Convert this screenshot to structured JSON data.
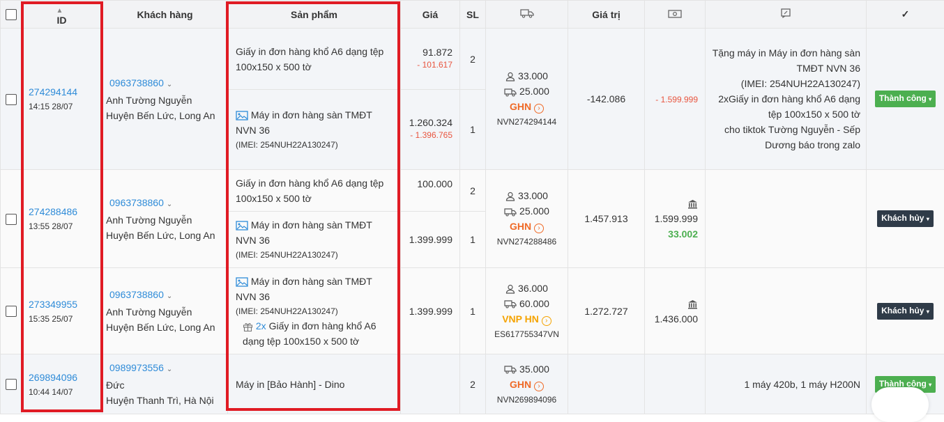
{
  "header": {
    "id": "ID",
    "customer": "Khách hàng",
    "product": "Sản phẩm",
    "price": "Giá",
    "qty": "SL",
    "shipping_icon": "truck-icon",
    "value": "Giá trị",
    "payment_icon": "money-icon",
    "note_icon": "note-icon",
    "status": "✓"
  },
  "orders": [
    {
      "id": "274294144",
      "time": "14:15 28/07",
      "phone": "0963738860",
      "name": "Anh Tường Nguyễn",
      "address": "Huyện Bến Lức, Long An",
      "p1": {
        "name": "Giấy in đơn hàng khổ A6 dạng tệp 100x150 x 500 tờ",
        "price": "91.872",
        "disc": "- 101.617",
        "qty": "2"
      },
      "p2": {
        "name": "Máy in đơn hàng sàn TMĐT NVN 36",
        "imei": "(IMEI: 254NUH22A130247)",
        "price": "1.260.324",
        "disc": "- 1.396.765",
        "qty": "1"
      },
      "ship_fee": "33.000",
      "ship_cost": "25.000",
      "carrier": "GHN",
      "tracking": "NVN274294144",
      "value": "-142.086",
      "payment": "- 1.599.999",
      "note": [
        "Tặng máy in Máy in đơn hàng sàn",
        "TMĐT NVN 36",
        "(IMEI: 254NUH22A130247)",
        "2xGiấy in đơn hàng khổ A6 dạng",
        "tệp 100x150 x 500 tờ",
        "cho tiktok Tường Nguyễn - Sếp",
        "Dương báo trong zalo"
      ],
      "status": "Thành công"
    },
    {
      "id": "274288486",
      "time": "13:55 28/07",
      "phone": "0963738860",
      "name": "Anh Tường Nguyễn",
      "address": "Huyện Bến Lức, Long An",
      "p1": {
        "name": "Giấy in đơn hàng khổ A6 dạng tệp 100x150 x 500 tờ",
        "price": "100.000",
        "qty": "2"
      },
      "p2": {
        "name": "Máy in đơn hàng sàn TMĐT NVN 36",
        "imei": "(IMEI: 254NUH22A130247)",
        "price": "1.399.999",
        "qty": "1"
      },
      "ship_fee": "33.000",
      "ship_cost": "25.000",
      "carrier": "GHN",
      "tracking": "NVN274288486",
      "value": "1.457.913",
      "payment": "1.599.999",
      "payment_extra": "33.002",
      "status": "Khách hủy"
    },
    {
      "id": "273349955",
      "time": "15:35 25/07",
      "phone": "0963738860",
      "name": "Anh Tường Nguyễn",
      "address": "Huyện Bến Lức, Long An",
      "p1": {
        "name": "Máy in đơn hàng sàn TMĐT NVN 36",
        "imei": "(IMEI: 254NUH22A130247)",
        "gift_qty": "2x",
        "gift_name": "Giấy in đơn hàng khổ A6 dạng tệp 100x150 x 500 tờ",
        "price": "1.399.999",
        "qty": "1"
      },
      "ship_fee": "36.000",
      "ship_cost": "60.000",
      "carrier": "VNP HN",
      "tracking": "ES617755347VN",
      "value": "1.272.727",
      "payment": "1.436.000",
      "status": "Khách hủy"
    },
    {
      "id": "269894096",
      "time": "10:44 14/07",
      "phone": "0989973556",
      "name": "Đức",
      "address": "Huyện Thanh Trì, Hà Nội",
      "p1": {
        "name": "Máy in [Bảo Hành] - Dino",
        "qty": "2"
      },
      "ship_cost": "35.000",
      "carrier": "GHN",
      "tracking": "NVN269894096",
      "note": "1 máy 420b, 1 máy H200N",
      "status": "Thành công"
    }
  ],
  "colors": {
    "link": "#2e8bd8",
    "discount": "#e8553f",
    "success": "#4caf50",
    "cancel": "#2f3b48",
    "highlight": "#e01b24",
    "ghn": "#ef6a27",
    "vnp": "#f5a300"
  }
}
